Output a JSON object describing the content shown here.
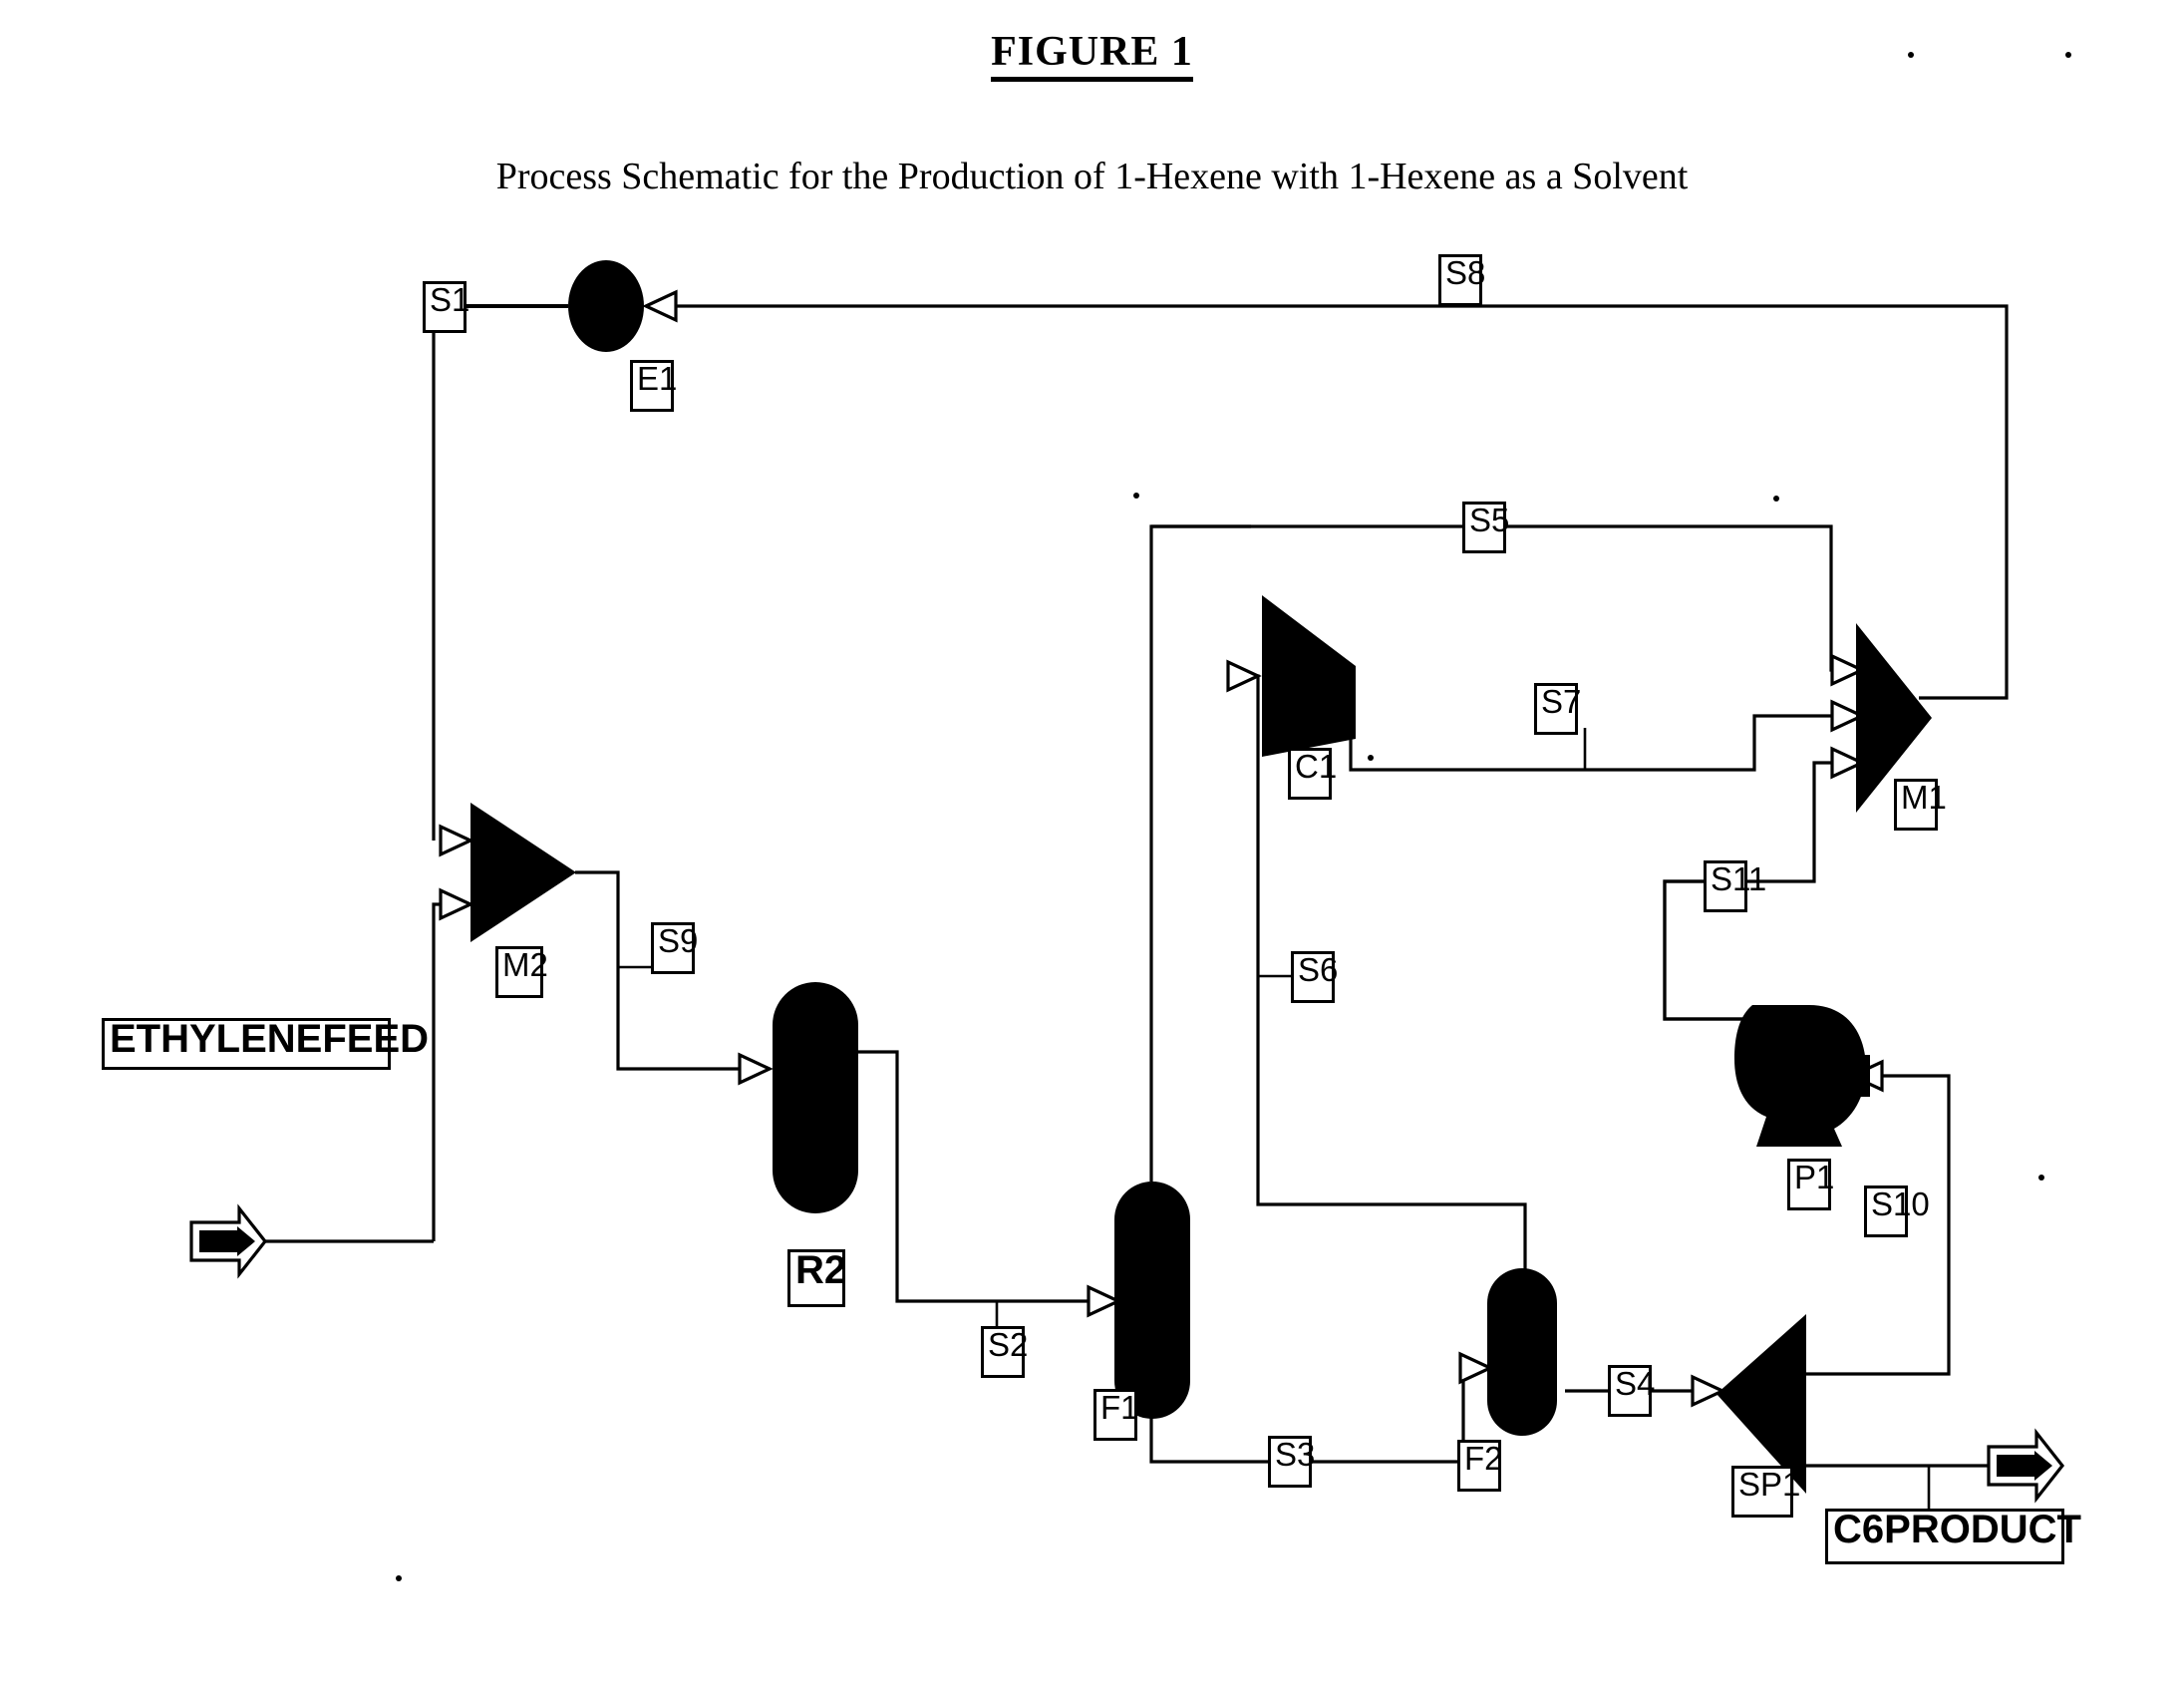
{
  "figure": {
    "title": "FIGURE 1",
    "subtitle": "Process Schematic for the Production of 1-Hexene with 1-Hexene as a Solvent"
  },
  "feeds": [
    {
      "id": "ethylenefeed",
      "label": "ETHYLENEFEED"
    }
  ],
  "products": [
    {
      "id": "c6product",
      "label": "C6PRODUCT"
    }
  ],
  "units": [
    {
      "id": "E1",
      "label": "E1",
      "type": "heat-exchanger"
    },
    {
      "id": "M2",
      "label": "M2",
      "type": "mixer"
    },
    {
      "id": "R2",
      "label": "R2",
      "type": "reactor"
    },
    {
      "id": "F1",
      "label": "F1",
      "type": "flash-vessel"
    },
    {
      "id": "F2",
      "label": "F2",
      "type": "flash-vessel"
    },
    {
      "id": "C1",
      "label": "C1",
      "type": "compressor"
    },
    {
      "id": "M1",
      "label": "M1",
      "type": "mixer"
    },
    {
      "id": "P1",
      "label": "P1",
      "type": "pump"
    },
    {
      "id": "SP1",
      "label": "SP1",
      "type": "splitter"
    }
  ],
  "streams": [
    {
      "id": "S1",
      "label": "S1"
    },
    {
      "id": "S2",
      "label": "S2"
    },
    {
      "id": "S3",
      "label": "S3"
    },
    {
      "id": "S4",
      "label": "S4"
    },
    {
      "id": "S5",
      "label": "S5"
    },
    {
      "id": "S6",
      "label": "S6"
    },
    {
      "id": "S7",
      "label": "S7"
    },
    {
      "id": "S8",
      "label": "S8"
    },
    {
      "id": "S9",
      "label": "S9"
    },
    {
      "id": "S10",
      "label": "S10"
    },
    {
      "id": "S11",
      "label": "S11"
    }
  ],
  "colors": {
    "ink": "#000000",
    "paper": "#ffffff"
  }
}
